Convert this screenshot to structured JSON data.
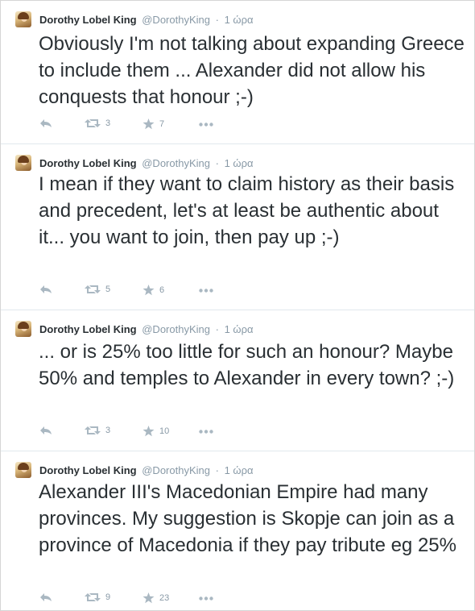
{
  "tweets": [
    {
      "name": "Dorothy Lobel King",
      "handle": "@DorothyKing",
      "separator": "·",
      "time": "1 ώρα",
      "text": "Obviously I'm not talking about expanding Greece to include them ... Alexander did not allow his conquests that honour ;-)",
      "retweets": "3",
      "favorites": "7"
    },
    {
      "name": "Dorothy Lobel King",
      "handle": "@DorothyKing",
      "separator": "·",
      "time": "1 ώρα",
      "text": "I mean if they want to claim history as their basis and precedent, let's at least be authentic about it... you want to join, then pay up ;-)",
      "retweets": "5",
      "favorites": "6"
    },
    {
      "name": "Dorothy Lobel King",
      "handle": "@DorothyKing",
      "separator": "·",
      "time": "1 ώρα",
      "text": "... or is 25% too little for such an honour? Maybe 50% and temples to Alexander in every town? ;-)",
      "retweets": "3",
      "favorites": "10"
    },
    {
      "name": "Dorothy Lobel King",
      "handle": "@DorothyKing",
      "separator": "·",
      "time": "1 ώρα",
      "text": "Alexander III's Macedonian Empire had many provinces. My suggestion is Skopje can join as a province of Macedonia if they pay tribute eg 25%",
      "retweets": "9",
      "favorites": "23"
    }
  ]
}
